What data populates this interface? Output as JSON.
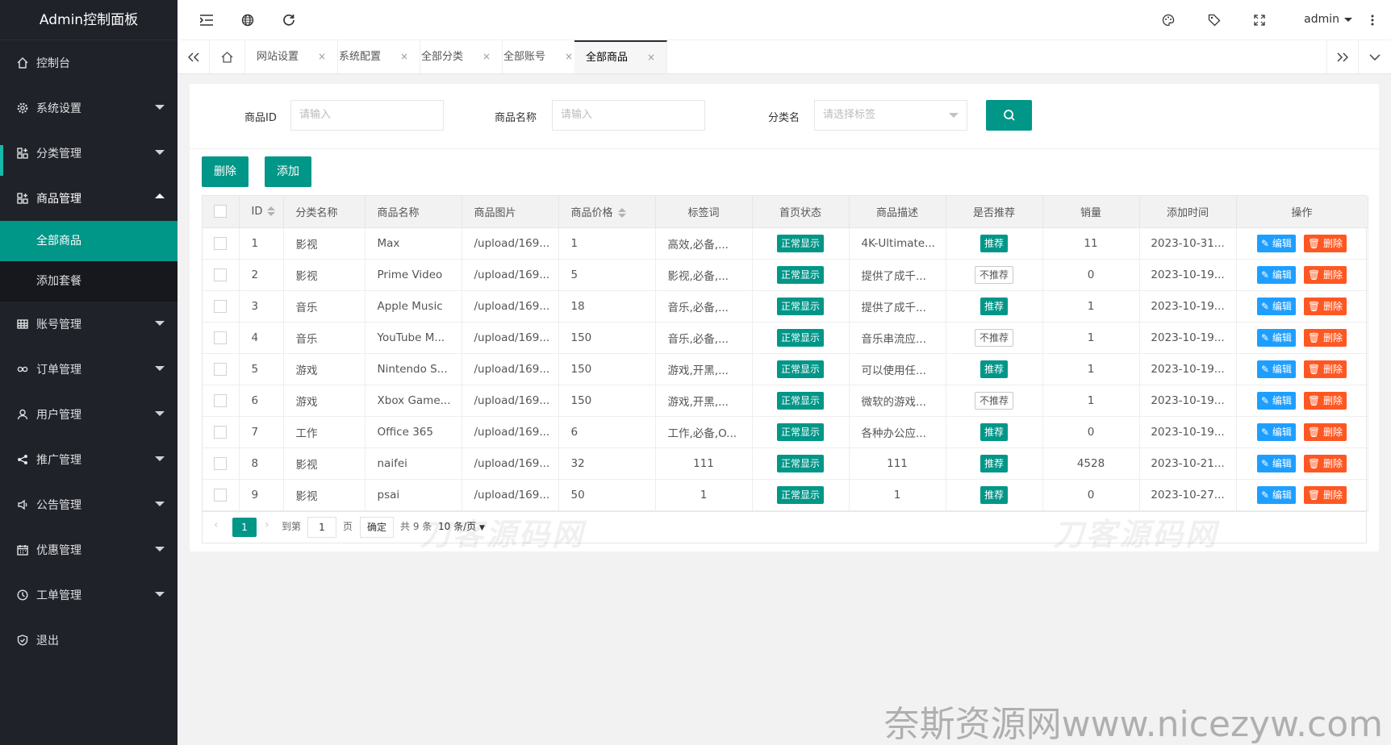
{
  "sidebar": {
    "logo": "Admin控制面板",
    "items": [
      {
        "label": "控制台",
        "icon": "home-icon",
        "arrow": ""
      },
      {
        "label": "系统设置",
        "icon": "gear-icon",
        "arrow": "down"
      },
      {
        "label": "分类管理",
        "icon": "apps-icon",
        "arrow": "down"
      },
      {
        "label": "商品管理",
        "icon": "apps-icon",
        "arrow": "up"
      }
    ],
    "sub_items": [
      {
        "label": "全部商品",
        "active": true
      },
      {
        "label": "添加套餐",
        "active": false
      }
    ],
    "items_after": [
      {
        "label": "账号管理",
        "icon": "table-icon"
      },
      {
        "label": "订单管理",
        "icon": "link-icon"
      },
      {
        "label": "用户管理",
        "icon": "user-icon"
      },
      {
        "label": "推广管理",
        "icon": "share-icon"
      },
      {
        "label": "公告管理",
        "icon": "speaker-icon"
      },
      {
        "label": "优惠管理",
        "icon": "calendar-icon"
      },
      {
        "label": "工单管理",
        "icon": "clock-icon"
      },
      {
        "label": "退出",
        "icon": "shield-icon"
      }
    ]
  },
  "header": {
    "user": "admin"
  },
  "tabs": {
    "items": [
      "网站设置",
      "系统配置",
      "全部分类",
      "全部账号",
      "全部商品"
    ],
    "close": "×",
    "active_index": 4
  },
  "search": {
    "id_label": "商品ID",
    "id_placeholder": "请输入",
    "name_label": "商品名称",
    "name_placeholder": "请输入",
    "cat_label": "分类名",
    "cat_placeholder": "请选择标签"
  },
  "toolbar": {
    "delete_label": "删除",
    "add_label": "添加"
  },
  "table": {
    "headers": [
      "ID",
      "分类名称",
      "商品名称",
      "商品图片",
      "商品价格",
      "标签词",
      "首页状态",
      "商品描述",
      "是否推荐",
      "销量",
      "添加时间",
      "操作"
    ],
    "rows": [
      {
        "id": "1",
        "cat": "影视",
        "name": "Max",
        "img": "/upload/169...",
        "price": "1",
        "tags": "高效,必备,...",
        "status": "正常显示",
        "desc": "4K-Ultimate...",
        "rec": "推荐",
        "rec_on": true,
        "sales": "11",
        "time": "2023-10-31..."
      },
      {
        "id": "2",
        "cat": "影视",
        "name": "Prime Video",
        "img": "/upload/169...",
        "price": "5",
        "tags": "影视,必备,...",
        "status": "正常显示",
        "desc": "提供了成千...",
        "rec": "不推荐",
        "rec_on": false,
        "sales": "0",
        "time": "2023-10-19..."
      },
      {
        "id": "3",
        "cat": "音乐",
        "name": "Apple Music",
        "img": "/upload/169...",
        "price": "18",
        "tags": "音乐,必备,...",
        "status": "正常显示",
        "desc": "提供了成千...",
        "rec": "推荐",
        "rec_on": true,
        "sales": "1",
        "time": "2023-10-19..."
      },
      {
        "id": "4",
        "cat": "音乐",
        "name": "YouTube M...",
        "img": "/upload/169...",
        "price": "150",
        "tags": "音乐,必备,...",
        "status": "正常显示",
        "desc": "音乐串流应...",
        "rec": "不推荐",
        "rec_on": false,
        "sales": "1",
        "time": "2023-10-19..."
      },
      {
        "id": "5",
        "cat": "游戏",
        "name": "Nintendo S...",
        "img": "/upload/169...",
        "price": "150",
        "tags": "游戏,开黑,...",
        "status": "正常显示",
        "desc": "可以使用任...",
        "rec": "推荐",
        "rec_on": true,
        "sales": "1",
        "time": "2023-10-19..."
      },
      {
        "id": "6",
        "cat": "游戏",
        "name": "Xbox Game...",
        "img": "/upload/169...",
        "price": "150",
        "tags": "游戏,开黑,...",
        "status": "正常显示",
        "desc": "微软的游戏...",
        "rec": "不推荐",
        "rec_on": false,
        "sales": "1",
        "time": "2023-10-19..."
      },
      {
        "id": "7",
        "cat": "工作",
        "name": "Office 365",
        "img": "/upload/169...",
        "price": "6",
        "tags": "工作,必备,O...",
        "status": "正常显示",
        "desc": "各种办公应...",
        "rec": "推荐",
        "rec_on": true,
        "sales": "0",
        "time": "2023-10-19..."
      },
      {
        "id": "8",
        "cat": "影视",
        "name": "naifei",
        "img": "/upload/169...",
        "price": "32",
        "tags": "111",
        "status": "正常显示",
        "desc": "111",
        "rec": "推荐",
        "rec_on": true,
        "sales": "4528",
        "time": "2023-10-21..."
      },
      {
        "id": "9",
        "cat": "影视",
        "name": "psai",
        "img": "/upload/169...",
        "price": "50",
        "tags": "1",
        "status": "正常显示",
        "desc": "1",
        "rec": "推荐",
        "rec_on": true,
        "sales": "0",
        "time": "2023-10-27..."
      }
    ],
    "edit_label": "编辑",
    "del_label": "删除"
  },
  "pager": {
    "current": "1",
    "goto_label": "到第",
    "goto_value": "1",
    "page_unit": "页",
    "confirm": "确定",
    "total": "共 9 条",
    "per_page": "10 条/页"
  },
  "watermarks": {
    "mark1": "刀客源码网",
    "mark2": "刀客源码网",
    "bottom": "奈斯资源网www.nicezyw.com"
  },
  "colors": {
    "primary": "#009688",
    "sidebar": "#20222a",
    "edit": "#1e9fff",
    "delete": "#ff5722"
  }
}
